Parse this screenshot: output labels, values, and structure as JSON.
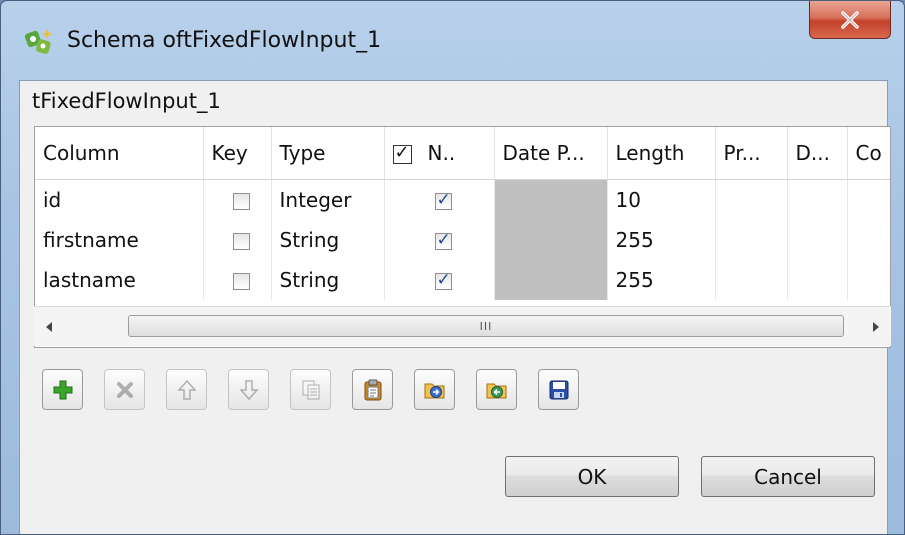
{
  "window": {
    "title": "Schema oftFixedFlowInput_1",
    "close_label": "X"
  },
  "panel": {
    "label": "tFixedFlowInput_1"
  },
  "table": {
    "headers": {
      "column": "Column",
      "key": "Key",
      "type": "Type",
      "nullable": "N..",
      "date_pattern": "Date P...",
      "length": "Length",
      "precision": "Pr...",
      "default": "D...",
      "comment": "Co"
    },
    "rows": [
      {
        "column": "id",
        "key": false,
        "type": "Integer",
        "nullable": true,
        "length": "10"
      },
      {
        "column": "firstname",
        "key": false,
        "type": "String",
        "nullable": true,
        "length": "255"
      },
      {
        "column": "lastname",
        "key": false,
        "type": "String",
        "nullable": true,
        "length": "255"
      }
    ]
  },
  "scrollbar": {
    "thumb_grip": "III"
  },
  "toolbar": {
    "buttons": [
      {
        "name": "add-icon",
        "enabled": true
      },
      {
        "name": "remove-icon",
        "enabled": false
      },
      {
        "name": "move-up-icon",
        "enabled": false
      },
      {
        "name": "move-down-icon",
        "enabled": false
      },
      {
        "name": "copy-icon",
        "enabled": false
      },
      {
        "name": "paste-icon",
        "enabled": true
      },
      {
        "name": "import-icon",
        "enabled": true
      },
      {
        "name": "export-icon",
        "enabled": true
      },
      {
        "name": "save-icon",
        "enabled": true
      }
    ]
  },
  "buttons": {
    "ok": "OK",
    "cancel": "Cancel"
  },
  "colors": {
    "add_green": "#3aa52a",
    "disabled_grey": "#9a9a9a",
    "folder_yellow": "#f2c14e",
    "save_blue": "#2b4fa8"
  }
}
